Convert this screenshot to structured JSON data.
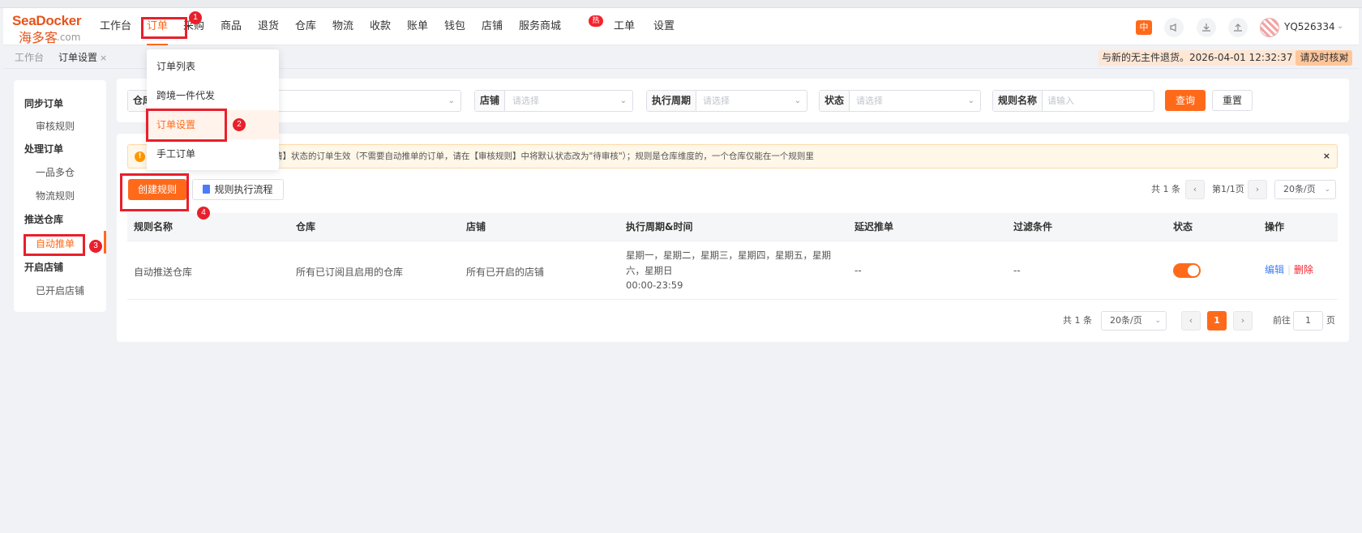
{
  "logo": {
    "brand": "SeaDocker",
    "cn": "海多客",
    "domain": ".com"
  },
  "nav": {
    "items": [
      "工作台",
      "订单",
      "采购",
      "商品",
      "退货",
      "仓库",
      "物流",
      "收款",
      "账单",
      "钱包",
      "店铺",
      "服务商城",
      "工单",
      "设置"
    ],
    "hot_badge": "热"
  },
  "toolbar": {
    "icon_orange": "中",
    "icons": [
      "megaphone-icon",
      "download-icon",
      "upload-icon"
    ],
    "username": "YQ526334"
  },
  "tabs": [
    {
      "label": "工作台",
      "active": false
    },
    {
      "label": "订单设置",
      "active": true,
      "close": "×"
    }
  ],
  "notice": {
    "text": "与新的无主件退货。2026-04-01 12:32:37",
    "action": "请及时核对",
    "close": "×"
  },
  "sidebar": {
    "groups": [
      {
        "title": "同步订单",
        "items": [
          "审核规则"
        ]
      },
      {
        "title": "处理订单",
        "items": [
          "一品多仓",
          "物流规则"
        ]
      },
      {
        "title": "推送仓库",
        "items": [
          "自动推单"
        ]
      },
      {
        "title": "开启店铺",
        "items": [
          "已开启店铺"
        ]
      }
    ],
    "active_item": "自动推单"
  },
  "filters": [
    {
      "label": "仓库",
      "placeholder": ""
    },
    {
      "label": "店铺",
      "placeholder": "请选择"
    },
    {
      "label": "执行周期",
      "placeholder": "请选择"
    },
    {
      "label": "状态",
      "placeholder": "请选择"
    },
    {
      "label": "规则名称",
      "placeholder": "请输入"
    }
  ],
  "filter_buttons": {
    "query": "查询",
    "reset": "重置"
  },
  "alert": {
    "text": "请】状态的订单生效（不需要自动推单的订单，请在【审核规则】中将默认状态改为\"待审核\"）；规则是仓库维度的，一个仓库仅能在一个规则里",
    "close": "×"
  },
  "actions": {
    "create": "创建规则",
    "flow": "规则执行流程"
  },
  "pager_top": {
    "total": "共 1 条",
    "page": "第1/1页",
    "size": "20条/页"
  },
  "table": {
    "headers": [
      "规则名称",
      "仓库",
      "店铺",
      "执行周期&时间",
      "延迟推单",
      "过滤条件",
      "状态",
      "操作"
    ],
    "rows": [
      {
        "name": "自动推送仓库",
        "warehouse": "所有已订阅且启用的仓库",
        "shop": "所有已开启的店铺",
        "period_line1": "星期一，星期二，星期三，星期四，星期五，星期",
        "period_line2": "六，星期日",
        "period_time": "00:00-23:59",
        "delay": "--",
        "filter": "--",
        "status_on": true,
        "edit": "编辑",
        "delete": "删除"
      }
    ]
  },
  "pager_bottom": {
    "total": "共 1 条",
    "size": "20条/页",
    "current": "1",
    "goto_prefix": "前往",
    "goto_value": "1",
    "goto_suffix": "页"
  },
  "dropdown": {
    "items": [
      "订单列表",
      "跨境一件代发",
      "订单设置",
      "手工订单"
    ],
    "highlighted": "订单设置"
  },
  "annotations": [
    "1",
    "2",
    "3",
    "4"
  ],
  "colors": {
    "accent": "#ff6a1a",
    "annotation": "#e8202c",
    "link": "#3d7ff5",
    "danger": "#f5222d"
  }
}
